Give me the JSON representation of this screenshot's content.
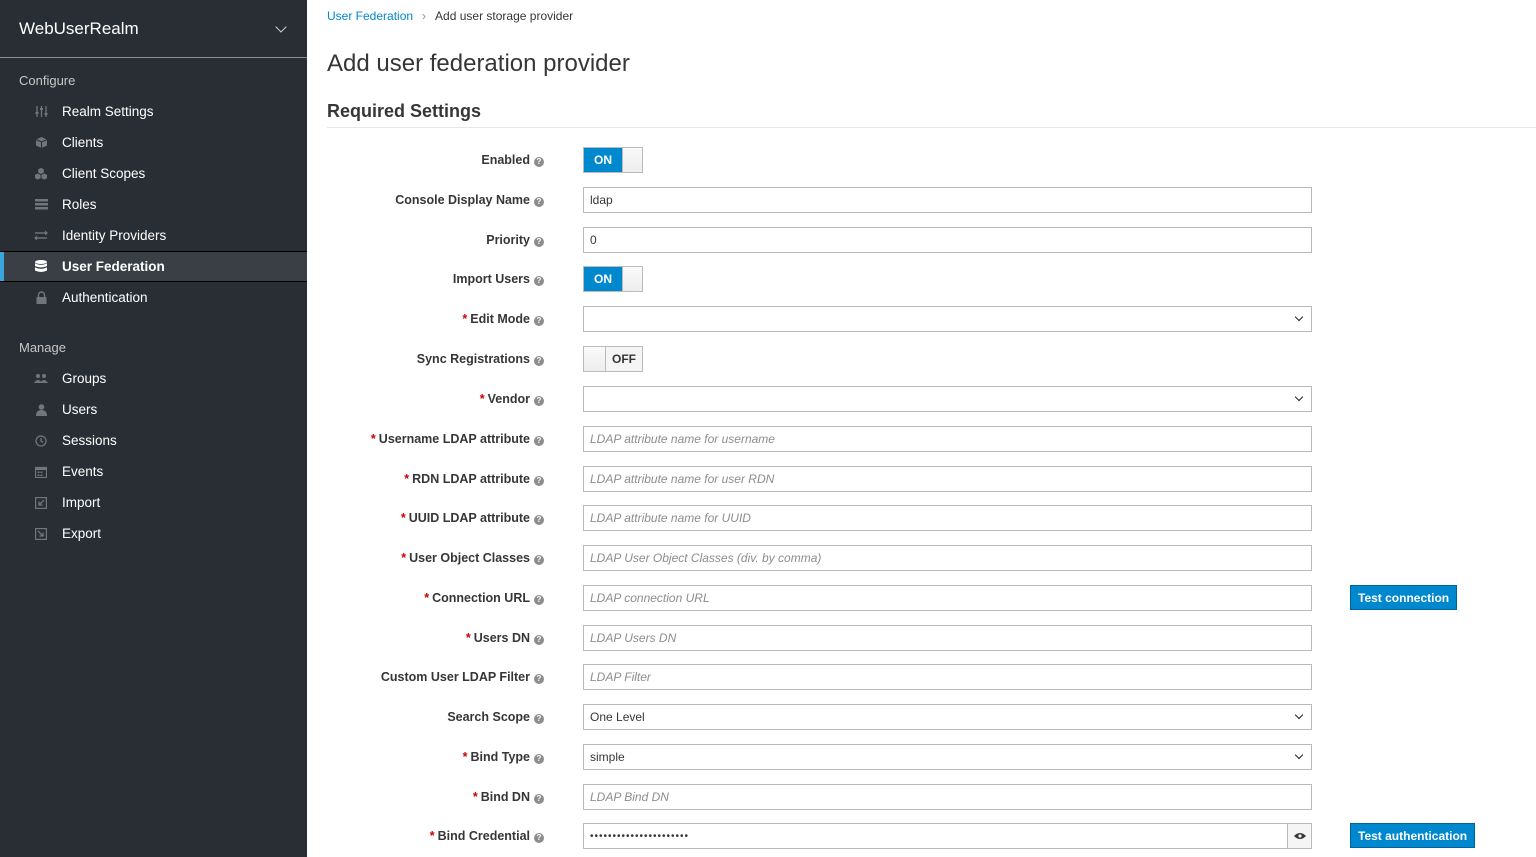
{
  "sidebar": {
    "realm": "WebUserRealm",
    "configure_title": "Configure",
    "manage_title": "Manage",
    "configure_items": [
      {
        "label": "Realm Settings",
        "icon": "sliders-icon"
      },
      {
        "label": "Clients",
        "icon": "cube-icon"
      },
      {
        "label": "Client Scopes",
        "icon": "cubes-icon"
      },
      {
        "label": "Roles",
        "icon": "list-icon"
      },
      {
        "label": "Identity Providers",
        "icon": "exchange-icon"
      },
      {
        "label": "User Federation",
        "icon": "database-icon",
        "active": true
      },
      {
        "label": "Authentication",
        "icon": "lock-icon"
      }
    ],
    "manage_items": [
      {
        "label": "Groups",
        "icon": "users-icon"
      },
      {
        "label": "Users",
        "icon": "user-icon"
      },
      {
        "label": "Sessions",
        "icon": "clock-icon"
      },
      {
        "label": "Events",
        "icon": "calendar-icon"
      },
      {
        "label": "Import",
        "icon": "import-icon"
      },
      {
        "label": "Export",
        "icon": "export-icon"
      }
    ]
  },
  "breadcrumb": {
    "parent": "User Federation",
    "current": "Add user storage provider"
  },
  "page_title": "Add user federation provider",
  "section_title": "Required Settings",
  "form": {
    "enabled": {
      "label": "Enabled",
      "value": "ON"
    },
    "console_display_name": {
      "label": "Console Display Name",
      "value": "ldap"
    },
    "priority": {
      "label": "Priority",
      "value": "0"
    },
    "import_users": {
      "label": "Import Users",
      "value": "ON"
    },
    "edit_mode": {
      "label": "Edit Mode",
      "value": ""
    },
    "sync_registrations": {
      "label": "Sync Registrations",
      "value": "OFF"
    },
    "vendor": {
      "label": "Vendor",
      "value": ""
    },
    "username_ldap_attribute": {
      "label": "Username LDAP attribute",
      "placeholder": "LDAP attribute name for username"
    },
    "rdn_ldap_attribute": {
      "label": "RDN LDAP attribute",
      "placeholder": "LDAP attribute name for user RDN"
    },
    "uuid_ldap_attribute": {
      "label": "UUID LDAP attribute",
      "placeholder": "LDAP attribute name for UUID"
    },
    "user_object_classes": {
      "label": "User Object Classes",
      "placeholder": "LDAP User Object Classes (div. by comma)"
    },
    "connection_url": {
      "label": "Connection URL",
      "placeholder": "LDAP connection URL",
      "button": "Test connection"
    },
    "users_dn": {
      "label": "Users DN",
      "placeholder": "LDAP Users DN"
    },
    "custom_user_ldap_filter": {
      "label": "Custom User LDAP Filter",
      "placeholder": "LDAP Filter"
    },
    "search_scope": {
      "label": "Search Scope",
      "value": "One Level"
    },
    "bind_type": {
      "label": "Bind Type",
      "value": "simple"
    },
    "bind_dn": {
      "label": "Bind DN",
      "placeholder": "LDAP Bind DN"
    },
    "bind_credential": {
      "label": "Bind Credential",
      "value": "••••••••••••••••••••••",
      "button": "Test authentication"
    }
  },
  "help_glyph": "?",
  "required_mark": "*",
  "breadcrumb_sep": "›",
  "colors": {
    "accent": "#0088ce",
    "sidebar_bg": "#292e34",
    "active_bar": "#39a5dc",
    "required": "#cc0000"
  }
}
